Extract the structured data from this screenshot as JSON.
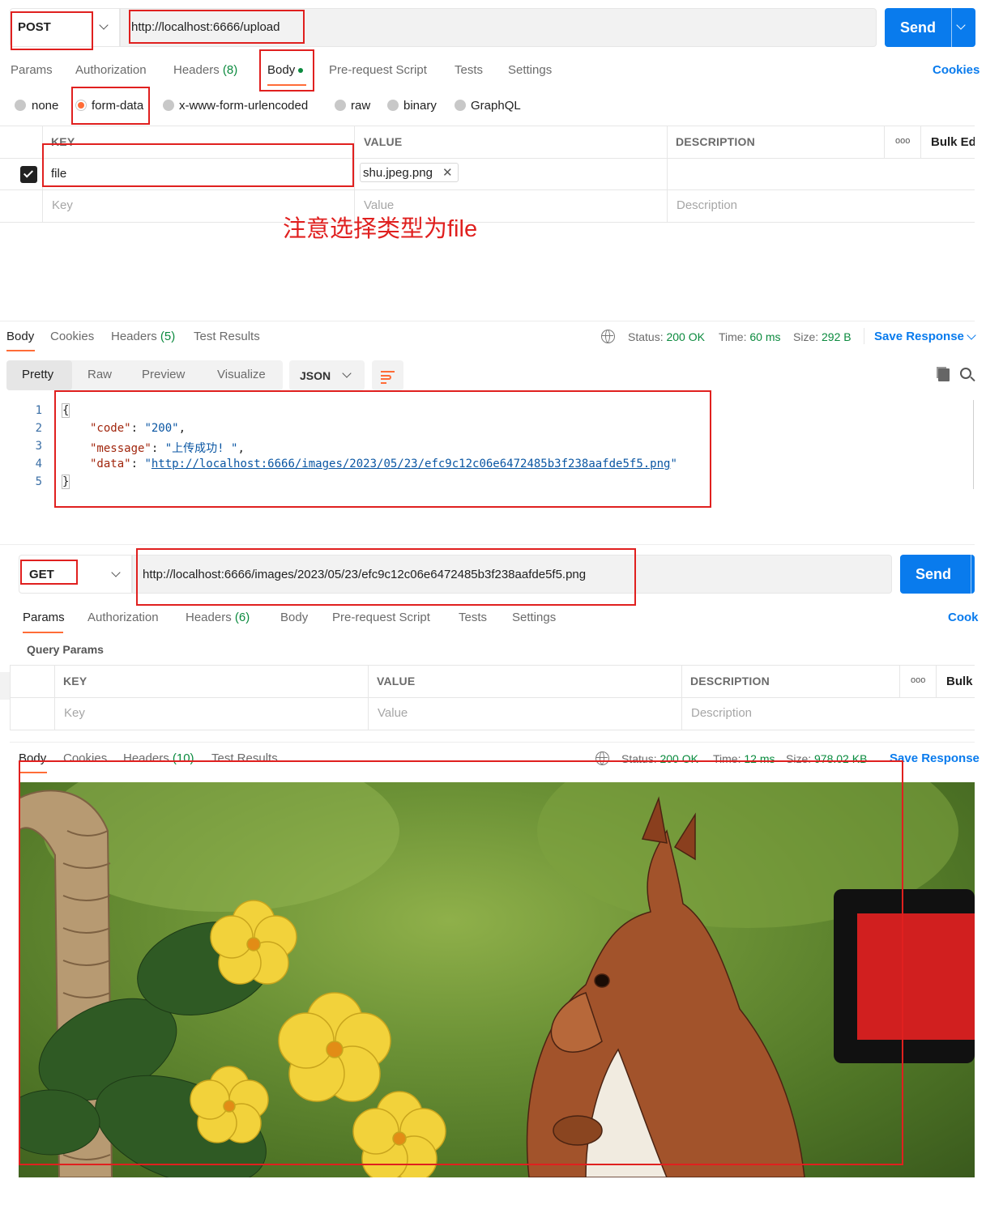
{
  "request1": {
    "method": "POST",
    "url": "http://localhost:6666/upload",
    "send_label": "Send",
    "cookies_label": "Cookies",
    "tabs": [
      {
        "label": "Params",
        "count": ""
      },
      {
        "label": "Authorization",
        "count": ""
      },
      {
        "label": "Headers",
        "count": "(8)"
      },
      {
        "label": "Body",
        "count": ""
      },
      {
        "label": "Pre-request Script",
        "count": ""
      },
      {
        "label": "Tests",
        "count": ""
      },
      {
        "label": "Settings",
        "count": ""
      }
    ],
    "body_types": [
      "none",
      "form-data",
      "x-www-form-urlencoded",
      "raw",
      "binary",
      "GraphQL"
    ],
    "selected_body_type": "form-data",
    "table": {
      "headers": [
        "KEY",
        "VALUE",
        "DESCRIPTION"
      ],
      "more_label": "ooo",
      "bulk_edit": "Bulk Edit",
      "rows": [
        {
          "key": "file",
          "value": "shu.jpeg.png",
          "checked": true
        }
      ],
      "placeholder": {
        "key": "Key",
        "value": "Value",
        "description": "Description"
      }
    },
    "annotation": "注意选择类型为file"
  },
  "response1": {
    "tabs": [
      {
        "label": "Body",
        "count": ""
      },
      {
        "label": "Cookies",
        "count": ""
      },
      {
        "label": "Headers",
        "count": "(5)"
      },
      {
        "label": "Test Results",
        "count": ""
      }
    ],
    "status_label": "Status:",
    "status_value": "200 OK",
    "time_label": "Time:",
    "time_value": "60 ms",
    "size_label": "Size:",
    "size_value": "292 B",
    "save_response": "Save Response",
    "view_modes": [
      "Pretty",
      "Raw",
      "Preview",
      "Visualize"
    ],
    "format": "JSON",
    "json_lines": {
      "open": "{",
      "code_key": "\"code\"",
      "code_val": "\"200\"",
      "message_key": "\"message\"",
      "message_val": "\"上传成功! \"",
      "data_key": "\"data\"",
      "data_val": "http://localhost:6666/images/2023/05/23/efc9c12c06e6472485b3f238aafde5f5.png",
      "close": "}"
    },
    "line_numbers": [
      "1",
      "2",
      "3",
      "4",
      "5"
    ]
  },
  "request2": {
    "method": "GET",
    "url": "http://localhost:6666/images/2023/05/23/efc9c12c06e6472485b3f238aafde5f5.png",
    "send_label": "Send",
    "cookies_label": "Cook",
    "tabs": [
      {
        "label": "Params",
        "count": ""
      },
      {
        "label": "Authorization",
        "count": ""
      },
      {
        "label": "Headers",
        "count": "(6)"
      },
      {
        "label": "Body",
        "count": ""
      },
      {
        "label": "Pre-request Script",
        "count": ""
      },
      {
        "label": "Tests",
        "count": ""
      },
      {
        "label": "Settings",
        "count": ""
      }
    ],
    "query_params_label": "Query Params",
    "table": {
      "headers": [
        "KEY",
        "VALUE",
        "DESCRIPTION"
      ],
      "more_label": "ooo",
      "bulk_edit": "Bulk",
      "placeholder": {
        "key": "Key",
        "value": "Value",
        "description": "Description"
      }
    }
  },
  "response2": {
    "tabs": [
      {
        "label": "Body",
        "count": ""
      },
      {
        "label": "Cookies",
        "count": ""
      },
      {
        "label": "Headers",
        "count": "(10)"
      },
      {
        "label": "Test Results",
        "count": ""
      }
    ],
    "status_label": "Status:",
    "status_value": "200 OK",
    "time_label": "Time:",
    "time_value": "12 ms",
    "size_label": "Size:",
    "size_value": "978.02 KB",
    "save_response": "Save Response",
    "image_subject": "squirrel photo"
  },
  "colors": {
    "accent_orange": "#ff6c37",
    "send_blue": "#097bed",
    "status_green": "#0b8a3e",
    "annotation_red": "#e0201f"
  }
}
